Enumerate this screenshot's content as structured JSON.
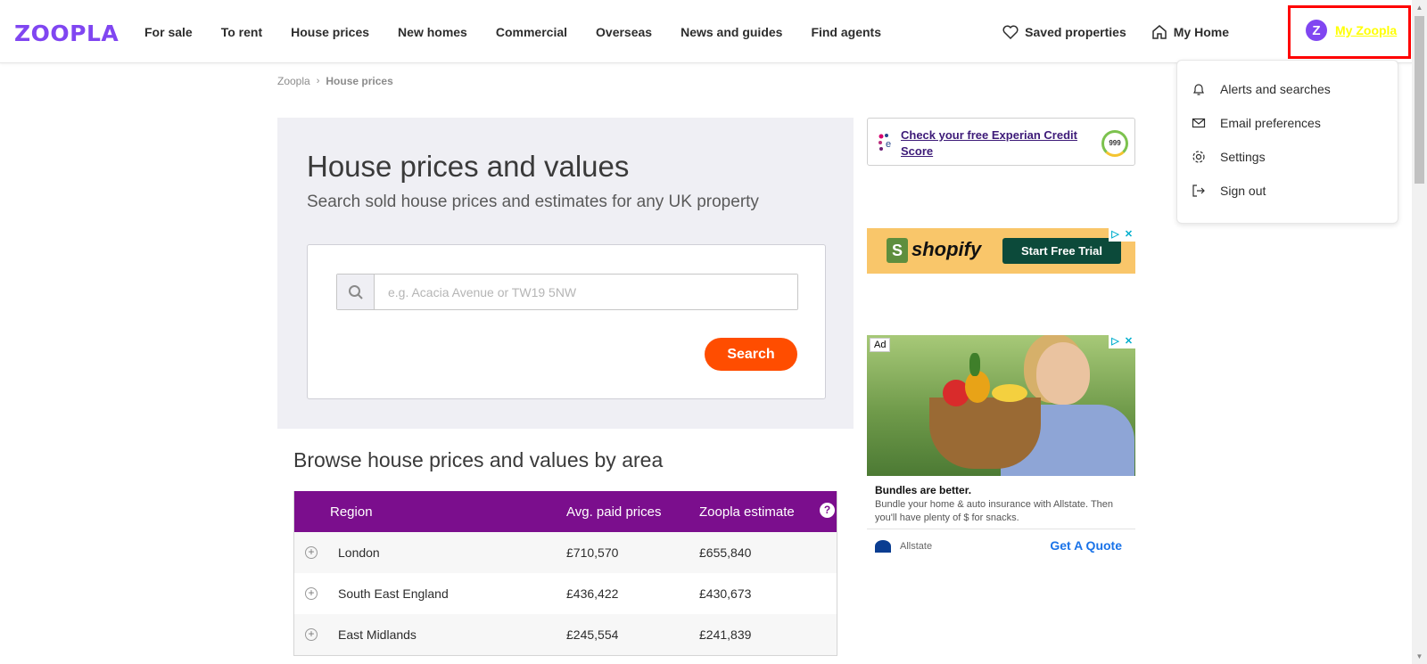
{
  "header": {
    "logo": "ZOOPLA",
    "nav": [
      "For sale",
      "To rent",
      "House prices",
      "New homes",
      "Commercial",
      "Overseas",
      "News and guides",
      "Find agents"
    ],
    "saved_properties": "Saved properties",
    "my_home": "My Home",
    "my_zoopla": "My Zoopla",
    "my_zoopla_initial": "Z"
  },
  "dropdown": {
    "items": [
      "Alerts and searches",
      "Email preferences",
      "Settings",
      "Sign out"
    ]
  },
  "breadcrumb": {
    "root": "Zoopla",
    "current": "House prices"
  },
  "hero": {
    "title": "House prices and values",
    "subtitle": "Search sold house prices and estimates for any UK property",
    "search_placeholder": "e.g. Acacia Avenue or TW19 5NW",
    "search_value": "",
    "search_button": "Search"
  },
  "browse": {
    "title": "Browse house prices and values by area",
    "columns": [
      "Region",
      "Avg. paid prices",
      "Zoopla estimate"
    ],
    "help": "?",
    "rows": [
      {
        "region": "London",
        "avg": "£710,570",
        "estimate": "£655,840"
      },
      {
        "region": "South East England",
        "avg": "£436,422",
        "estimate": "£430,673"
      },
      {
        "region": "East Midlands",
        "avg": "£245,554",
        "estimate": "£241,839"
      }
    ]
  },
  "experian": {
    "link": "Check your free Experian Credit Score",
    "gauge": "999"
  },
  "shopify_ad": {
    "brand": "shopify",
    "cta": "Start Free Trial"
  },
  "allstate_ad": {
    "tag": "Ad",
    "headline": "Bundles are better.",
    "body": "Bundle your home & auto insurance with Allstate. Then you'll have plenty of $ for snacks.",
    "brand": "Allstate",
    "cta": "Get A Quote"
  },
  "colors": {
    "brand": "#8046f1",
    "search_button": "#ff4d00",
    "table_header": "#7b0e8d",
    "highlight_box": "#ff0000"
  }
}
